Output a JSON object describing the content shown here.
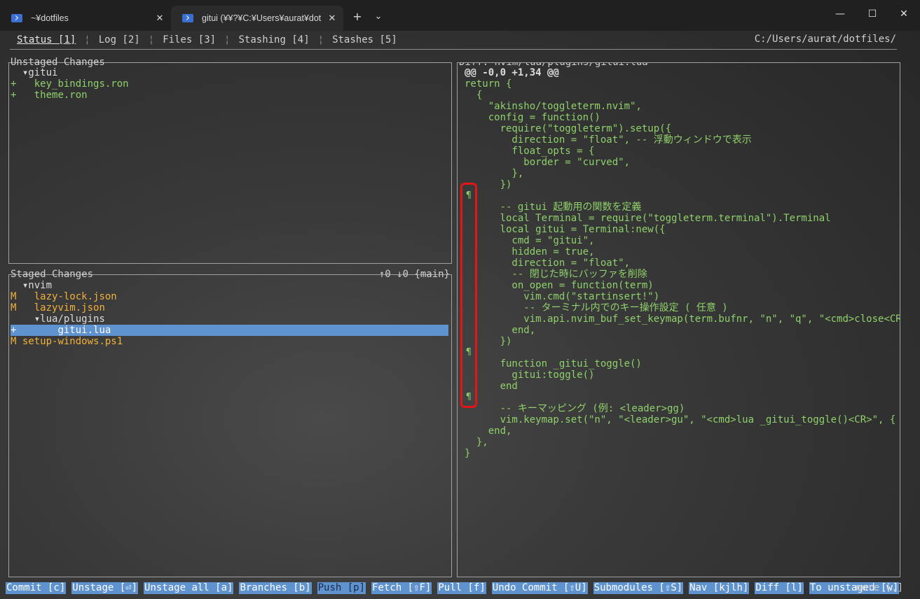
{
  "window": {
    "tabs": [
      {
        "title": "~¥dotfiles",
        "close": "✕"
      },
      {
        "title": "gitui (¥¥?¥C:¥Users¥aurat¥dot",
        "close": "✕"
      }
    ],
    "new_tab": "+",
    "dropdown": "⌄",
    "controls": {
      "minimize": "—",
      "maximize": "☐",
      "close": "✕"
    }
  },
  "nav": {
    "tabs": [
      "Status [1]",
      "Log [2]",
      "Files [3]",
      "Stashing [4]",
      "Stashes [5]"
    ],
    "separator": "¦",
    "path": "C:/Users/aurat/dotfiles/"
  },
  "unstaged": {
    "title": "Unstaged Changes",
    "items": [
      {
        "marker": "",
        "text": "  ▾gitui"
      },
      {
        "marker": "+",
        "text": "   key_bindings.ron"
      },
      {
        "marker": "+",
        "text": "   theme.ron"
      }
    ]
  },
  "staged": {
    "title": "Staged Changes",
    "branch_info": "↑0 ↓0 {main}",
    "items": [
      {
        "marker": "",
        "text": "  ▾nvim"
      },
      {
        "marker": "M",
        "text": "   lazy-lock.json"
      },
      {
        "marker": "M",
        "text": "   lazyvim.json"
      },
      {
        "marker": "",
        "text": "    ▾lua/plugins"
      },
      {
        "marker": "+",
        "text": "       gitui.lua"
      },
      {
        "marker": "M",
        "text": " setup-windows.ps1"
      }
    ]
  },
  "diff": {
    "title": "Diff: nvim/lua/plugins/gitui.lua",
    "hunk_header": "@@ -0,0 +1,34 @@",
    "lines": [
      "return {",
      "  {",
      "    \"akinsho/toggleterm.nvim\",",
      "    config = function()",
      "      require(\"toggleterm\").setup({",
      "        direction = \"float\", -- 浮動ウィンドウで表示",
      "        float_opts = {",
      "          border = \"curved\",",
      "        },",
      "      })",
      "",
      "      -- gitui 起動用の関数を定義",
      "      local Terminal = require(\"toggleterm.terminal\").Terminal",
      "      local gitui = Terminal:new({",
      "        cmd = \"gitui\",",
      "        hidden = true,",
      "        direction = \"float\",",
      "        -- 閉じた時にバッファを削除",
      "        on_open = function(term)",
      "          vim.cmd(\"startinsert!\")",
      "          -- ターミナル内でのキー操作設定 ( 任意 )",
      "          vim.api.nvim_buf_set_keymap(term.bufnr, \"n\", \"q\", \"<cmd>close<CR>\",",
      "        end,",
      "      })",
      "",
      "      function _gitui_toggle()",
      "        gitui:toggle()",
      "      end",
      "",
      "      -- キーマッピング (例: <leader>gg)",
      "      vim.keymap.set(\"n\", \"<leader>gu\", \"<cmd>lua _gitui_toggle()<CR>\", { des",
      "    end,",
      "  },",
      "}"
    ],
    "pilcrow": "¶"
  },
  "commands": [
    "Commit [c]",
    "Unstage [⏎]",
    "Unstage all [a]",
    "Branches [b]",
    "Push [p]",
    "Fetch [⇧F]",
    "Pull [f]",
    "Undo Commit [⇧U]",
    "Submodules [⇧S]",
    "Nav [kjlh]",
    "Diff [l]",
    "To unstaged [w]"
  ],
  "more": "more [.]"
}
